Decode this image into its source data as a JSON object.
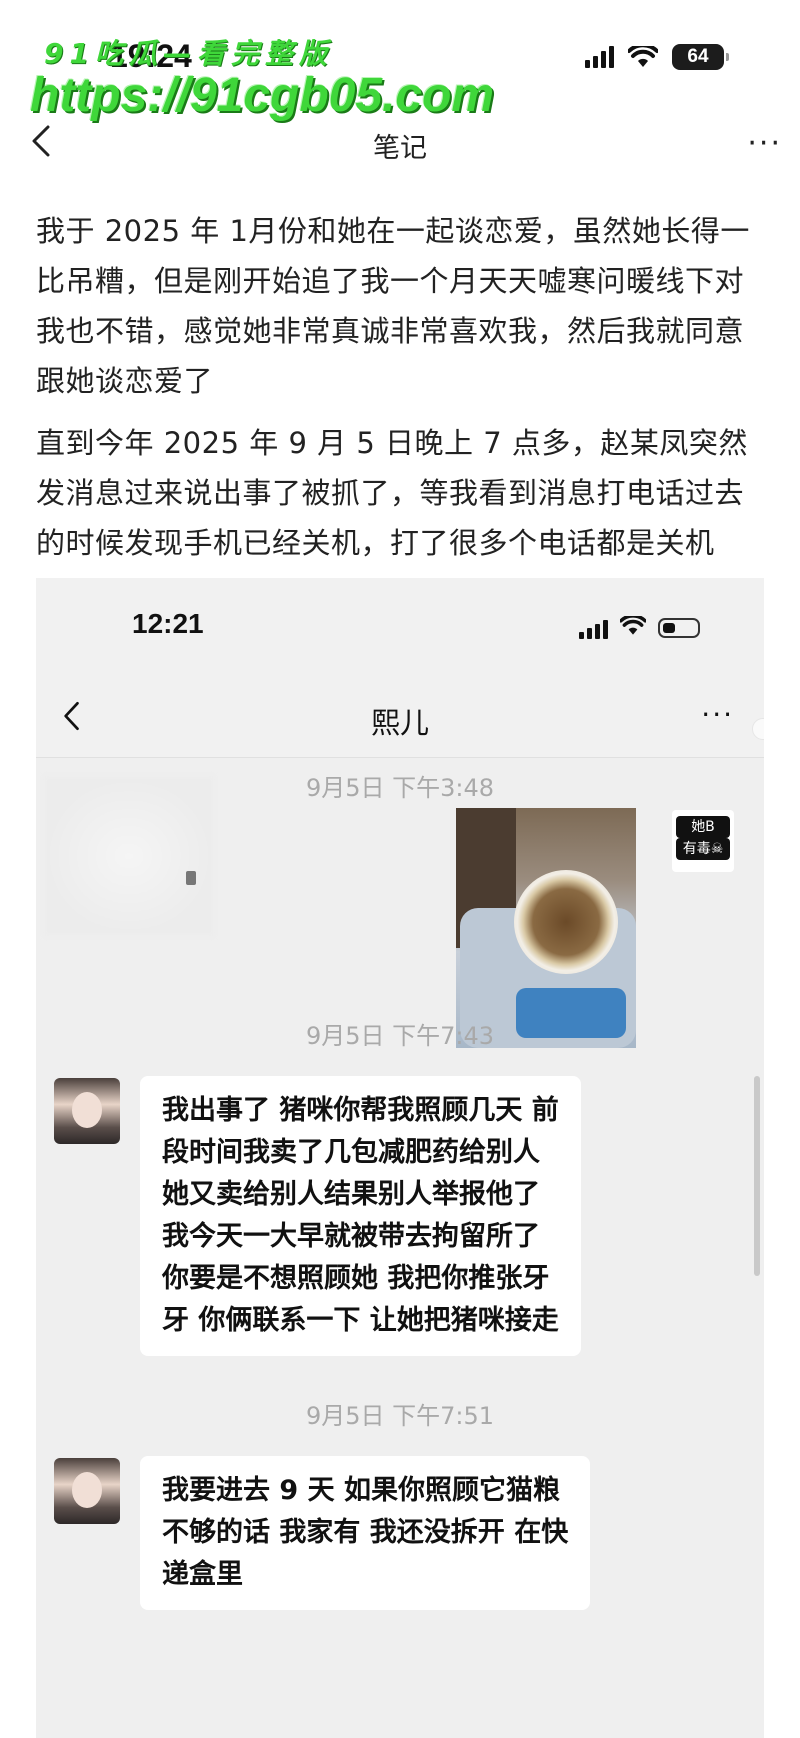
{
  "status_bar": {
    "time": "19:24",
    "battery": "64"
  },
  "watermark": {
    "line1": "91吃瓜—看完整版",
    "line2": "https://91cgb05.com"
  },
  "nav": {
    "title": "笔记",
    "more": "···"
  },
  "note": {
    "paragraphs": [
      "我于 2025 年 1月份和她在一起谈恋爱，虽然她长得一比吊糟，但是刚开始追了我一个月天天嘘寒问暖线下对我也不错，感觉她非常真诚非常喜欢我，然后我就同意跟她谈恋爱了",
      "直到今年 2025 年 9 月 5 日晚上 7 点多，赵某凤突然发消息过来说出事了被抓了，等我看到消息打电话过去的时候发现手机已经关机，打了很多个电话都是关机"
    ]
  },
  "screenshot": {
    "status_time": "12:21",
    "chat_title": "熙儿",
    "more": "···",
    "timestamps": [
      "9月5日 下午3:48",
      "9月5日 下午7:43",
      "9月5日 下午7:51"
    ],
    "sticker_text": [
      "她B",
      "有毒☠"
    ],
    "messages": [
      {
        "lines": [
          "我出事了 猪咪你帮我照顾几天 前",
          "段时间我卖了几包减肥药给别人",
          "她又卖给别人结果别人举报他了",
          "我今天一大早就被带去拘留所了",
          "你要是不想照顾她 我把你推张牙",
          "牙 你俩联系一下 让她把猪咪接走"
        ]
      },
      {
        "lines": [
          "我要进去 9 天 如果你照顾它猫粮",
          "不够的话 我家有 我还没拆开 在快",
          "递盒里"
        ]
      }
    ]
  }
}
